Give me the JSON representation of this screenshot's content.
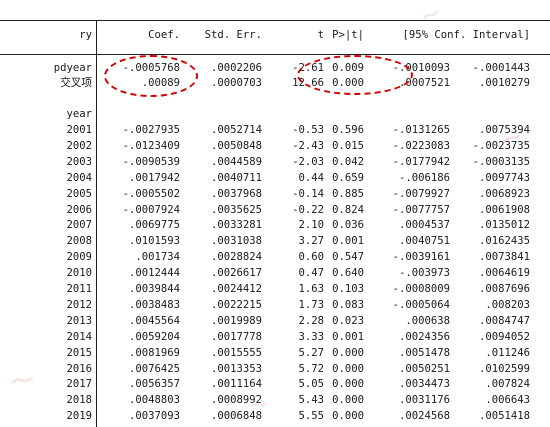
{
  "header": {
    "depvar": "ry",
    "coef": "Coef.",
    "se": "Std. Err.",
    "t": "t",
    "p": "P>|t|",
    "ci": "[95% Conf. Interval]"
  },
  "vars": [
    {
      "name": "pdyear",
      "coef": "-.0005768",
      "se": ".0002206",
      "t": "-2.61",
      "p": "0.009",
      "lo": "-.0010093",
      "hi": "-.0001443"
    },
    {
      "name": "交叉项",
      "coef": ".00089",
      "se": ".0000703",
      "t": "12.66",
      "p": "0.000",
      "lo": ".0007521",
      "hi": ".0010279"
    }
  ],
  "group_label": "year",
  "years": [
    {
      "y": "2001",
      "coef": "-.0027935",
      "se": ".0052714",
      "t": "-0.53",
      "p": "0.596",
      "lo": "-.0131265",
      "hi": ".0075394"
    },
    {
      "y": "2002",
      "coef": "-.0123409",
      "se": ".0050848",
      "t": "-2.43",
      "p": "0.015",
      "lo": "-.0223083",
      "hi": "-.0023735"
    },
    {
      "y": "2003",
      "coef": "-.0090539",
      "se": ".0044589",
      "t": "-2.03",
      "p": "0.042",
      "lo": "-.0177942",
      "hi": "-.0003135"
    },
    {
      "y": "2004",
      "coef": ".0017942",
      "se": ".0040711",
      "t": "0.44",
      "p": "0.659",
      "lo": "-.006186",
      "hi": ".0097743"
    },
    {
      "y": "2005",
      "coef": "-.0005502",
      "se": ".0037968",
      "t": "-0.14",
      "p": "0.885",
      "lo": "-.0079927",
      "hi": ".0068923"
    },
    {
      "y": "2006",
      "coef": "-.0007924",
      "se": ".0035625",
      "t": "-0.22",
      "p": "0.824",
      "lo": "-.0077757",
      "hi": ".0061908"
    },
    {
      "y": "2007",
      "coef": ".0069775",
      "se": ".0033281",
      "t": "2.10",
      "p": "0.036",
      "lo": ".0004537",
      "hi": ".0135012"
    },
    {
      "y": "2008",
      "coef": ".0101593",
      "se": ".0031038",
      "t": "3.27",
      "p": "0.001",
      "lo": ".0040751",
      "hi": ".0162435"
    },
    {
      "y": "2009",
      "coef": ".001734",
      "se": ".0028824",
      "t": "0.60",
      "p": "0.547",
      "lo": "-.0039161",
      "hi": ".0073841"
    },
    {
      "y": "2010",
      "coef": ".0012444",
      "se": ".0026617",
      "t": "0.47",
      "p": "0.640",
      "lo": "-.003973",
      "hi": ".0064619"
    },
    {
      "y": "2011",
      "coef": ".0039844",
      "se": ".0024412",
      "t": "1.63",
      "p": "0.103",
      "lo": "-.0008009",
      "hi": ".0087696"
    },
    {
      "y": "2012",
      "coef": ".0038483",
      "se": ".0022215",
      "t": "1.73",
      "p": "0.083",
      "lo": "-.0005064",
      "hi": ".008203"
    },
    {
      "y": "2013",
      "coef": ".0045564",
      "se": ".0019989",
      "t": "2.28",
      "p": "0.023",
      "lo": ".000638",
      "hi": ".0084747"
    },
    {
      "y": "2014",
      "coef": ".0059204",
      "se": ".0017778",
      "t": "3.33",
      "p": "0.001",
      "lo": ".0024356",
      "hi": ".0094052"
    },
    {
      "y": "2015",
      "coef": ".0081969",
      "se": ".0015555",
      "t": "5.27",
      "p": "0.000",
      "lo": ".0051478",
      "hi": ".011246"
    },
    {
      "y": "2016",
      "coef": ".0076425",
      "se": ".0013353",
      "t": "5.72",
      "p": "0.000",
      "lo": ".0050251",
      "hi": ".0102599"
    },
    {
      "y": "2017",
      "coef": ".0056357",
      "se": ".0011164",
      "t": "5.05",
      "p": "0.000",
      "lo": ".0034473",
      "hi": ".007824"
    },
    {
      "y": "2018",
      "coef": ".0048803",
      "se": ".0008992",
      "t": "5.43",
      "p": "0.000",
      "lo": ".0031176",
      "hi": ".006643"
    },
    {
      "y": "2019",
      "coef": ".0037093",
      "se": ".0006848",
      "t": "5.55",
      "p": "0.000",
      "lo": ".0024568",
      "hi": ".0051418"
    }
  ],
  "highlight_color": "#d60000"
}
